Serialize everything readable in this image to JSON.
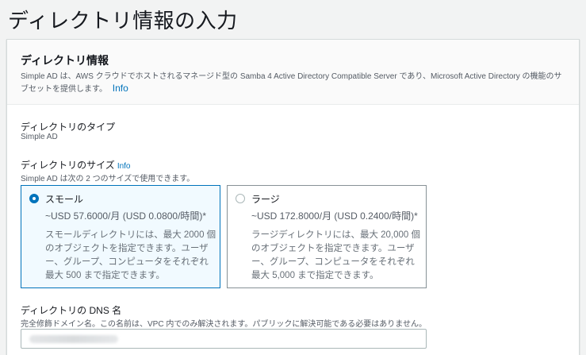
{
  "page": {
    "title": "ディレクトリ情報の入力"
  },
  "panel": {
    "title": "ディレクトリ情報",
    "description": "Simple AD は、AWS クラウドでホストされるマネージド型の Samba 4 Active Directory Compatible Server であり、Microsoft Active Directory の機能のサブセットを提供します。",
    "info_label": "Info"
  },
  "directory_type": {
    "label": "ディレクトリのタイプ",
    "value": "Simple AD"
  },
  "directory_size": {
    "label": "ディレクトリのサイズ",
    "info_label": "Info",
    "hint": "Simple AD は次の 2 つのサイズで使用できます。",
    "selected": "small",
    "options": [
      {
        "id": "small",
        "name": "スモール",
        "price": "~USD 57.6000/月 (USD 0.0800/時間)*",
        "description": "スモールディレクトリには、最大 2000 個のオブジェクトを指定できます。ユーザー、グループ、コンピュータをそれぞれ最大 500 まで指定できます。"
      },
      {
        "id": "large",
        "name": "ラージ",
        "price": "~USD 172.8000/月 (USD 0.2400/時間)*",
        "description": "ラージディレクトリには、最大 20,000 個のオブジェクトを指定できます。ユーザー、グループ、コンピュータをそれぞれ最大 5,000 まで指定できます。"
      }
    ]
  },
  "dns_name": {
    "label": "ディレクトリの DNS 名",
    "hint": "完全修飾ドメイン名。この名前は、VPC 内でのみ解決されます。パブリックに解決可能である必要はありません。"
  },
  "colors": {
    "accent": "#0073bb",
    "background": "#f2f3f3",
    "text": "#16191f",
    "muted": "#545b64"
  }
}
